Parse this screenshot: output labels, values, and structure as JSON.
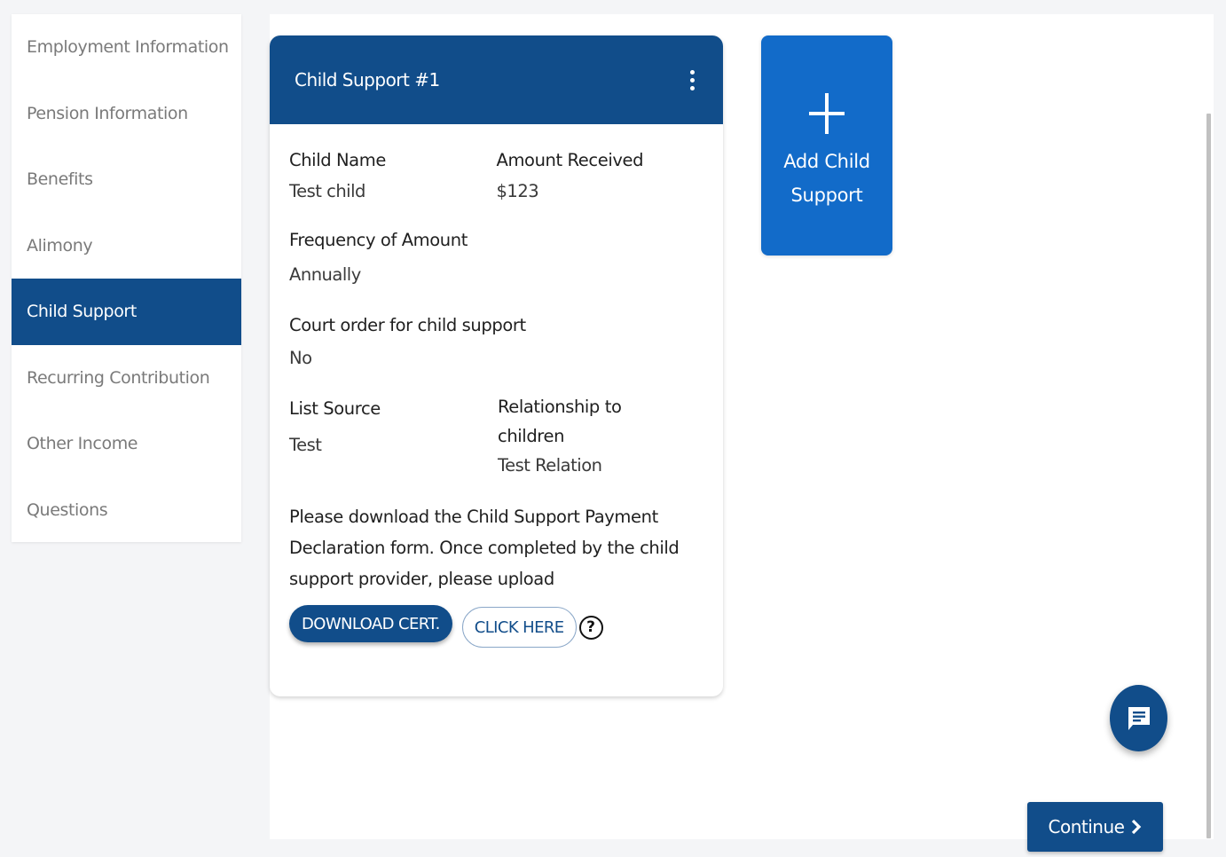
{
  "sidebar": {
    "items": [
      {
        "label": "Employment Information",
        "active": false
      },
      {
        "label": "Pension Information",
        "active": false
      },
      {
        "label": "Benefits",
        "active": false
      },
      {
        "label": "Alimony",
        "active": false
      },
      {
        "label": "Child Support",
        "active": true
      },
      {
        "label": "Recurring Contribution",
        "active": false
      },
      {
        "label": "Other Income",
        "active": false
      },
      {
        "label": "Questions",
        "active": false
      }
    ]
  },
  "card": {
    "title": "Child Support #1",
    "fields": {
      "child_name": {
        "label": "Child Name",
        "value": "Test child"
      },
      "amount_received": {
        "label": "Amount Received",
        "value": "$123"
      },
      "frequency": {
        "label": "Frequency of Amount",
        "value": "Annually"
      },
      "court_order": {
        "label": "Court order for child support",
        "value": "No"
      },
      "list_source": {
        "label": "List Source",
        "value": "Test"
      },
      "relationship": {
        "label": "Relationship to children",
        "value": "Test Relation"
      }
    },
    "note": "Please download the Child Support Payment Declaration form. Once completed by the child support provider, please upload",
    "download_label": "DOWNLOAD CERT.",
    "click_here_label": "CLICK HERE",
    "help_glyph": "?"
  },
  "add_card": {
    "label": "Add Child Support",
    "icon": "plus-icon"
  },
  "fab": {
    "icon": "chat-message-icon"
  },
  "footer": {
    "continue_label": "Continue",
    "continue_icon": "chevron-right-icon"
  },
  "colors": {
    "primary": "#114d8a",
    "accent": "#126bc9",
    "background": "#f4f5f7"
  }
}
